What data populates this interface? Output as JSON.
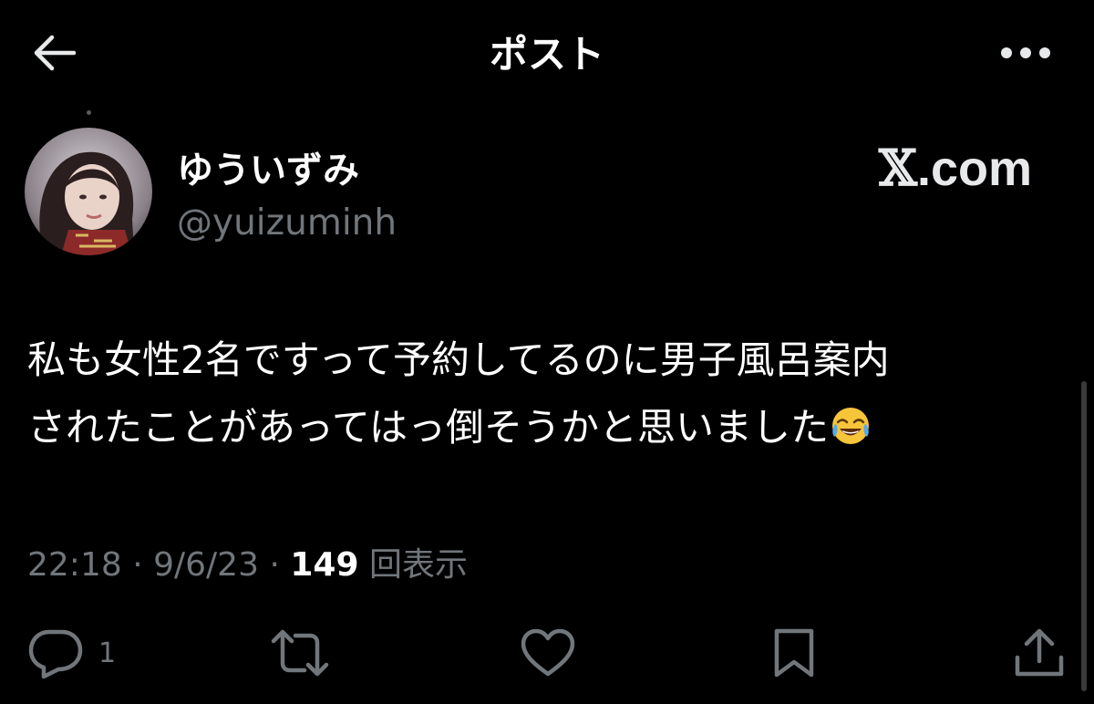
{
  "header": {
    "title": "ポスト",
    "back_icon": "arrow-left-icon",
    "more_icon": "more-horizontal-icon"
  },
  "author": {
    "display_name": "ゆういずみ",
    "handle": "@yuizumin​h",
    "avatar": "avatar-photo"
  },
  "watermark": {
    "x_glyph": "𝕏",
    "domain": ".com"
  },
  "post": {
    "text_line1": "私も女性2名ですって予約してるのに男子風呂案内",
    "text_line2": "されたことがあってはっ倒そうかと思いました",
    "emoji": "face-with-tears-of-joy"
  },
  "meta": {
    "time": "22:18",
    "separator": "·",
    "date": "9/6/23",
    "views_count": "149",
    "views_label": "回表示"
  },
  "actions": {
    "reply_count": "1",
    "icons": [
      "reply-icon",
      "repost-icon",
      "like-icon",
      "bookmark-icon",
      "share-icon"
    ]
  },
  "colors": {
    "background": "#000000",
    "primary_text": "#ffffff",
    "secondary_text": "#71767b"
  }
}
